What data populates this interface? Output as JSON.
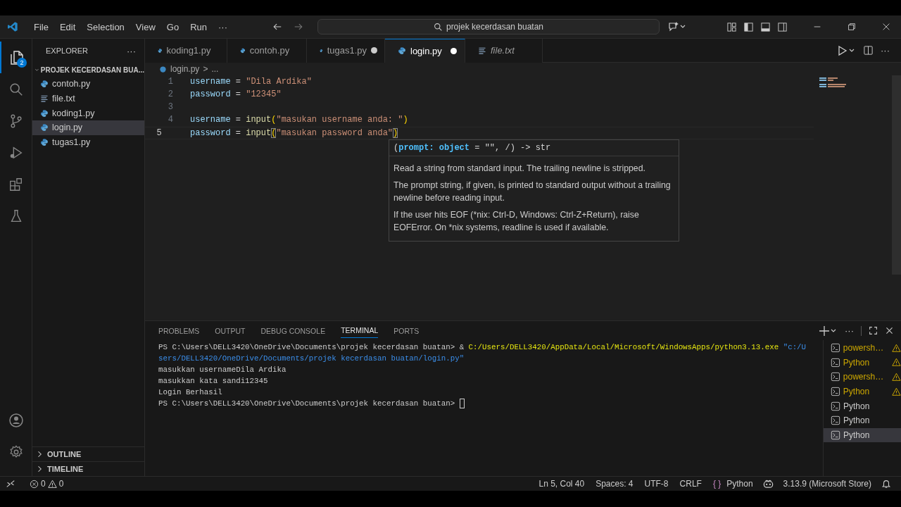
{
  "title_bar": {
    "menus": [
      "File",
      "Edit",
      "Selection",
      "View",
      "Go",
      "Run"
    ],
    "more": "···",
    "command_center": "projek kecerdasan buatan"
  },
  "activity_bar": {
    "items": [
      {
        "kind": "files",
        "selected": true,
        "badge": "2"
      },
      {
        "kind": "search",
        "selected": false
      },
      {
        "kind": "source-control",
        "selected": false
      },
      {
        "kind": "run",
        "selected": false
      },
      {
        "kind": "extensions",
        "selected": false
      },
      {
        "kind": "testing",
        "selected": false
      }
    ],
    "bottom": [
      {
        "kind": "account"
      },
      {
        "kind": "settings"
      }
    ]
  },
  "sidebar": {
    "title": "EXPLORER",
    "more": "···",
    "folder": {
      "name": "PROJEK KECERDASAN BUA...",
      "expanded": true,
      "files": [
        {
          "name": "contoh.py",
          "kind": "py",
          "selected": false
        },
        {
          "name": "file.txt",
          "kind": "txt",
          "selected": false
        },
        {
          "name": "koding1.py",
          "kind": "py",
          "selected": false
        },
        {
          "name": "login.py",
          "kind": "py",
          "selected": true
        },
        {
          "name": "tugas1.py",
          "kind": "py",
          "selected": false
        }
      ]
    },
    "sections": [
      {
        "name": "OUTLINE",
        "expanded": false
      },
      {
        "name": "TIMELINE",
        "expanded": false
      }
    ]
  },
  "tabs": [
    {
      "label": "koding1.py",
      "kind": "py",
      "selected": false,
      "dirty": false,
      "preview": false
    },
    {
      "label": "contoh.py",
      "kind": "py",
      "selected": false,
      "dirty": false,
      "preview": false
    },
    {
      "label": "tugas1.py",
      "kind": "py",
      "selected": false,
      "dirty": true,
      "preview": false
    },
    {
      "label": "login.py",
      "kind": "py",
      "selected": true,
      "dirty": true,
      "preview": false
    },
    {
      "label": "file.txt",
      "kind": "txt",
      "selected": false,
      "dirty": false,
      "preview": true
    }
  ],
  "breadcrumb": {
    "file": "login.py",
    "separator": ">",
    "rest": "..."
  },
  "code": [
    {
      "number": "1",
      "active": false,
      "tokens": [
        {
          "text": "username",
          "kind": "var"
        },
        {
          "text": " = ",
          "kind": "op"
        },
        {
          "text": "\"Dila Ardika\"",
          "kind": "str"
        }
      ]
    },
    {
      "number": "2",
      "active": false,
      "tokens": [
        {
          "text": "password",
          "kind": "var"
        },
        {
          "text": " = ",
          "kind": "op"
        },
        {
          "text": "\"12345\"",
          "kind": "str"
        }
      ]
    },
    {
      "number": "3",
      "active": false
    },
    {
      "number": "4",
      "active": false,
      "tokens": [
        {
          "text": "username",
          "kind": "var"
        },
        {
          "text": " = ",
          "kind": "op"
        },
        {
          "text": "input",
          "kind": "fn"
        },
        {
          "text": "(",
          "kind": "paren"
        },
        {
          "text": "\"masukan username anda: \"",
          "kind": "str"
        },
        {
          "text": ")",
          "kind": "paren"
        }
      ]
    },
    {
      "number": "5",
      "active": true,
      "tokens": [
        {
          "text": "password",
          "kind": "var"
        },
        {
          "text": " = ",
          "kind": "op"
        },
        {
          "text": "input",
          "kind": "fn"
        },
        {
          "text": "(",
          "kind": "match"
        },
        {
          "text": "\"masukan password anda\"",
          "kind": "str"
        },
        {
          "text": ")",
          "kind": "match"
        }
      ]
    }
  ],
  "hover": {
    "signature": [
      {
        "text": "(",
        "kind": "punct"
      },
      {
        "text": "prompt: object",
        "kind": "param"
      },
      {
        "text": " = \"\", /) -> str",
        "kind": "punct"
      }
    ],
    "paragraphs": [
      "Read a string from standard input. The trailing newline is stripped.",
      "The prompt string, if given, is printed to standard output without a trailing newline before reading input.",
      "If the user hits EOF (*nix: Ctrl-D, Windows: Ctrl-Z+Return), raise EOFError. On *nix systems, readline is used if available."
    ]
  },
  "panel": {
    "tabs": [
      {
        "label": "PROBLEMS",
        "selected": false
      },
      {
        "label": "OUTPUT",
        "selected": false
      },
      {
        "label": "DEBUG CONSOLE",
        "selected": false
      },
      {
        "label": "TERMINAL",
        "selected": true
      },
      {
        "label": "PORTS",
        "selected": false
      }
    ],
    "terminal": [
      {
        "cursor": false,
        "segments": [
          {
            "text": "PS C:\\Users\\DELL3420\\OneDrive\\Documents\\projek kecerdasan buatan> & ",
            "kind": "plain"
          },
          {
            "text": "C:/Users/DELL3420/AppData/Local/Microsoft/WindowsApps/python3.13.exe",
            "kind": "cmd"
          },
          {
            "text": " \"c:/U",
            "kind": "str"
          }
        ]
      },
      {
        "cursor": false,
        "segments": [
          {
            "text": "sers/DELL3420/OneDrive/Documents/projek kecerdasan buatan/login.py\"",
            "kind": "str"
          }
        ]
      },
      {
        "cursor": false,
        "segments": [
          {
            "text": "masukkan usernameDila Ardika",
            "kind": "plain"
          }
        ]
      },
      {
        "cursor": false,
        "segments": [
          {
            "text": "masukkan kata sandi12345",
            "kind": "plain"
          }
        ]
      },
      {
        "cursor": false,
        "segments": [
          {
            "text": "Login Berhasil",
            "kind": "plain"
          }
        ]
      },
      {
        "cursor": true,
        "segments": [
          {
            "text": "PS C:\\Users\\DELL3420\\OneDrive\\Documents\\projek kecerdasan buatan> ",
            "kind": "plain"
          }
        ]
      }
    ],
    "terminals": [
      {
        "name": "powersh…",
        "warning": true,
        "selected": false
      },
      {
        "name": "Python",
        "warning": true,
        "selected": false
      },
      {
        "name": "powersh…",
        "warning": true,
        "selected": false
      },
      {
        "name": "Python",
        "warning": true,
        "selected": false
      },
      {
        "name": "Python",
        "warning": false,
        "selected": false
      },
      {
        "name": "Python",
        "warning": false,
        "selected": false
      },
      {
        "name": "Python",
        "warning": false,
        "selected": true
      }
    ]
  },
  "status_bar": {
    "errors": "0",
    "warnings": "0",
    "position": "Ln 5, Col 40",
    "spaces": "Spaces: 4",
    "encoding": "UTF-8",
    "eol": "CRLF",
    "language_mark": "{ }",
    "language": "Python",
    "interpreter": "3.13.9 (Microsoft Store)"
  }
}
